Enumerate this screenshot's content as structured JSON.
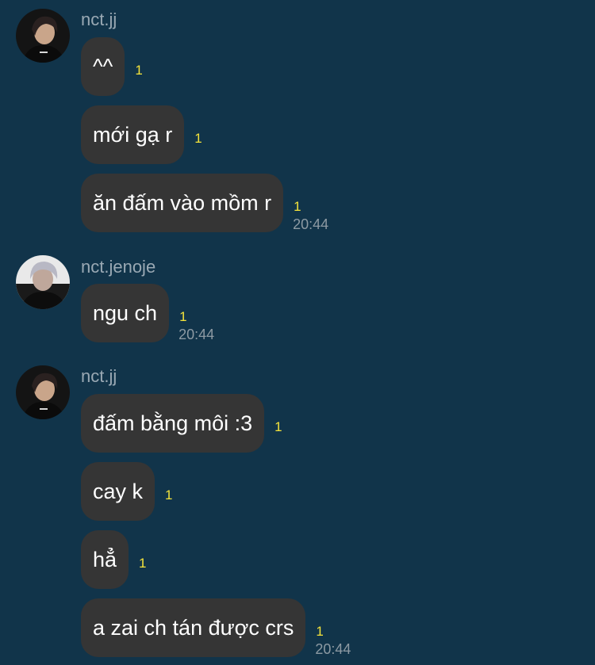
{
  "colors": {
    "background": "#11344a",
    "bubble": "#353535",
    "message_text": "#ffffff",
    "sender_name": "#9aa9b4",
    "read_count": "#f4e33b",
    "timestamp": "#8d9aa3"
  },
  "groups": [
    {
      "sender": "nct.jj",
      "avatar_icon": "profile-photo-dark-hair",
      "messages": [
        {
          "text": "^^",
          "read": "1",
          "time": ""
        },
        {
          "text": "mới gạ r",
          "read": "1",
          "time": ""
        },
        {
          "text": "ăn đấm vào mồm r",
          "read": "1",
          "time": "20:44"
        }
      ]
    },
    {
      "sender": "nct.jenoje",
      "avatar_icon": "profile-photo-light-hair",
      "messages": [
        {
          "text": "ngu ch",
          "read": "1",
          "time": "20:44"
        }
      ]
    },
    {
      "sender": "nct.jj",
      "avatar_icon": "profile-photo-dark-hair",
      "messages": [
        {
          "text": "đấm bằng môi :3",
          "read": "1",
          "time": ""
        },
        {
          "text": "cay k",
          "read": "1",
          "time": ""
        },
        {
          "text": "hẳ",
          "read": "1",
          "time": ""
        },
        {
          "text": "a zai ch tán được crs",
          "read": "1",
          "time": "20:44"
        }
      ]
    }
  ]
}
